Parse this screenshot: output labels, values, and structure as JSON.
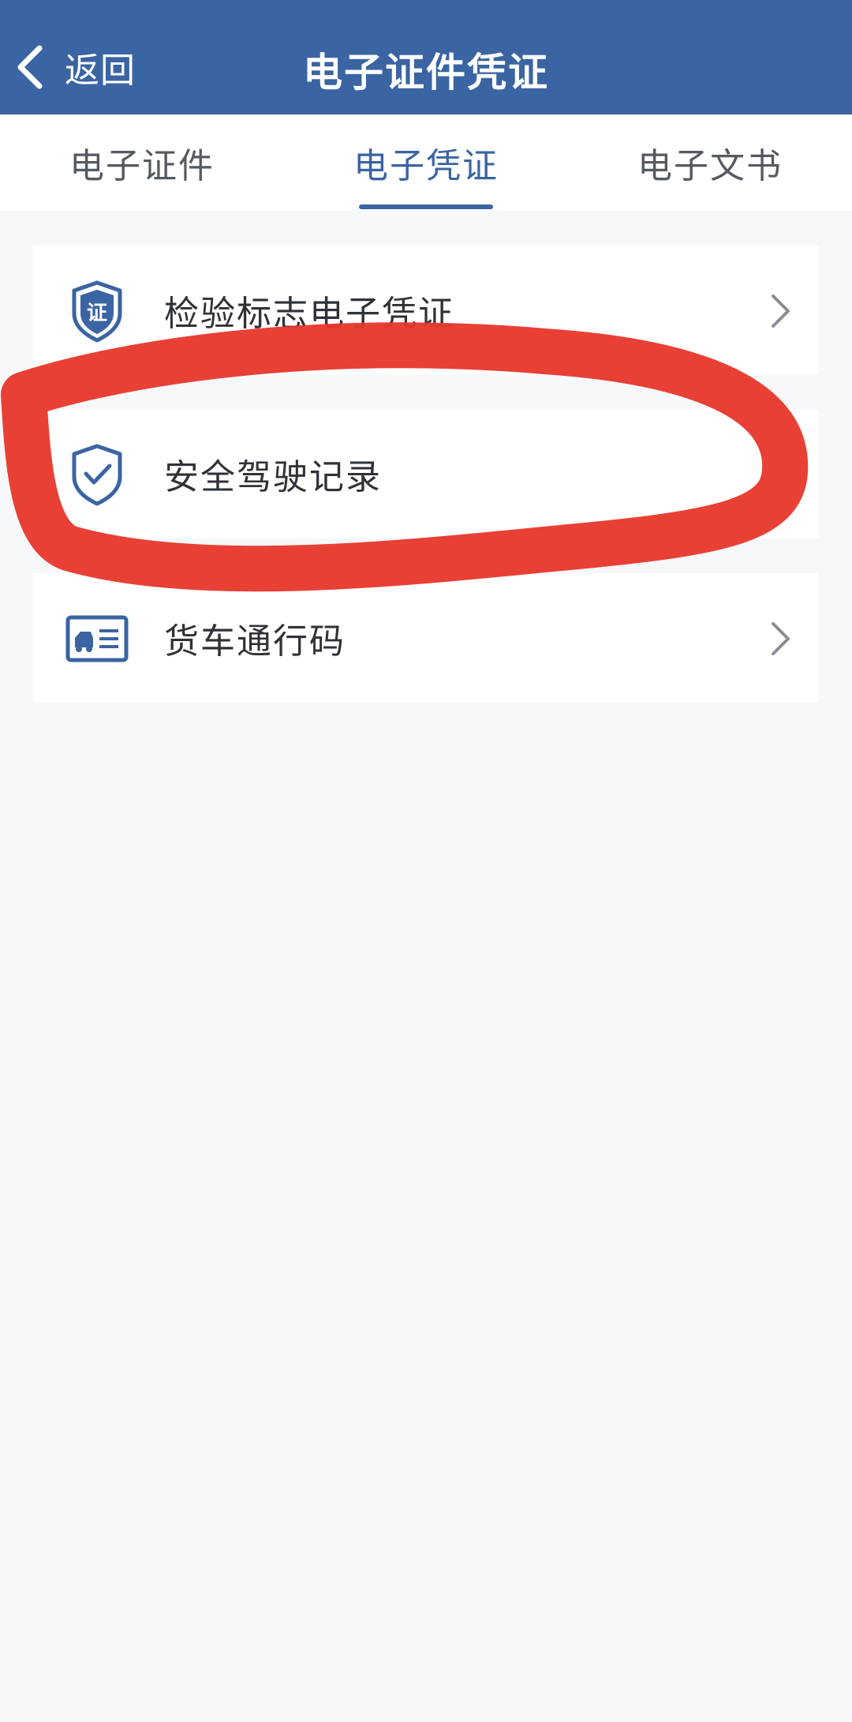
{
  "header": {
    "back_label": "返回",
    "title": "电子证件凭证",
    "background": "#3b64a2"
  },
  "tabs": [
    {
      "label": "电子证件",
      "active": false
    },
    {
      "label": "电子凭证",
      "active": true
    },
    {
      "label": "电子文书",
      "active": false
    }
  ],
  "list": [
    {
      "label": "检验标志电子凭证",
      "icon": "shield-certificate-icon",
      "has_chevron": true
    },
    {
      "label": "安全驾驶记录",
      "icon": "shield-check-icon",
      "has_chevron": false
    },
    {
      "label": "货车通行码",
      "icon": "truck-card-icon",
      "has_chevron": true
    }
  ],
  "icon_badge_text": "证",
  "colors": {
    "accent": "#3b64a2",
    "annotation": "#e8362b",
    "page_bg": "#f6f8fa"
  }
}
